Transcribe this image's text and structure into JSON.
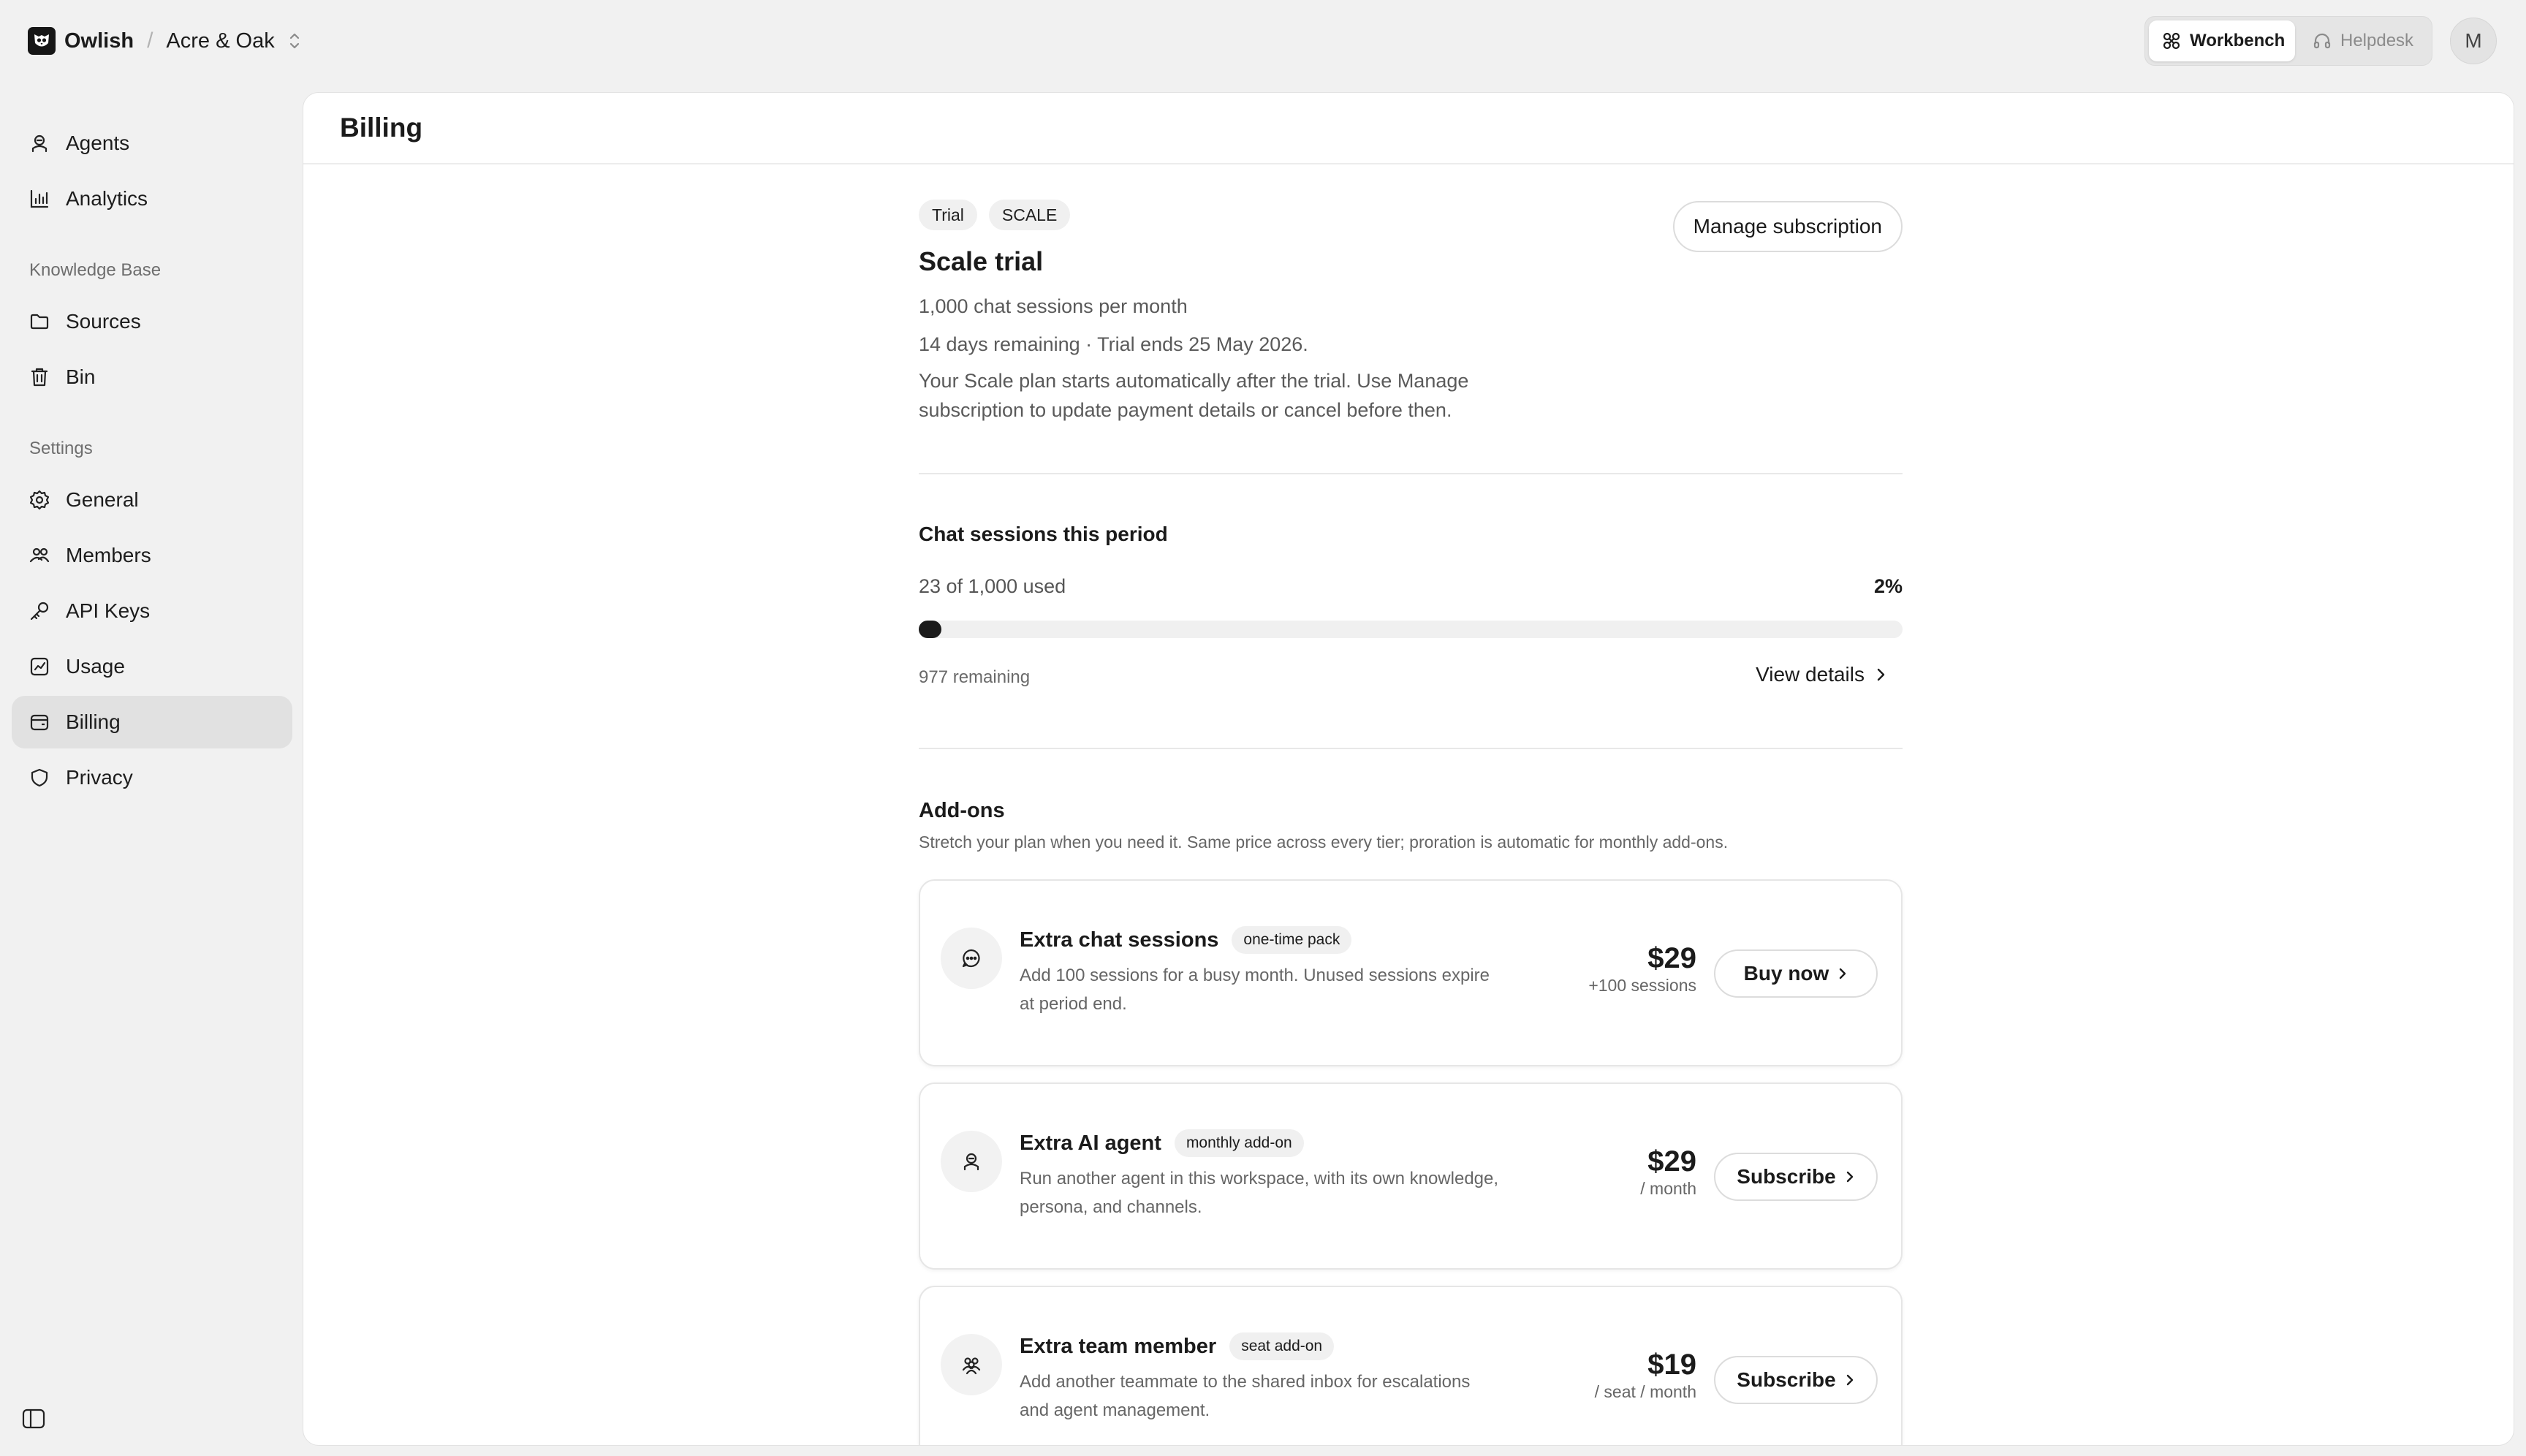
{
  "brand": {
    "name": "Owlish"
  },
  "workspace": {
    "name": "Acre & Oak"
  },
  "modes": {
    "workbench": "Workbench",
    "helpdesk": "Helpdesk"
  },
  "user": {
    "initial": "M"
  },
  "sidebar": {
    "top": [
      "Agents",
      "Analytics"
    ],
    "kb_heading": "Knowledge Base",
    "kb": [
      "Sources",
      "Bin"
    ],
    "settings_heading": "Settings",
    "settings": [
      "General",
      "Members",
      "API Keys",
      "Usage",
      "Billing",
      "Privacy"
    ],
    "active": "Billing"
  },
  "page": {
    "title": "Billing"
  },
  "plan": {
    "badges": [
      "Trial",
      "SCALE"
    ],
    "title": "Scale trial",
    "sessions": "1,000 chat sessions per month",
    "remaining": "14 days remaining · Trial ends 25 May 2026.",
    "note": "Your Scale plan starts automatically after the trial. Use Manage subscription to update payment details or cancel before then.",
    "manage_label": "Manage subscription"
  },
  "usage": {
    "title": "Chat sessions this period",
    "used_text": "23 of 1,000 used",
    "percent_label": "2%",
    "fraction": 0.023,
    "remaining_text": "977 remaining",
    "details_label": "View details"
  },
  "addons": {
    "title": "Add-ons",
    "subtitle": "Stretch your plan when you need it. Same price across every tier; proration is automatic for monthly add-ons.",
    "items": [
      {
        "name": "Extra chat sessions",
        "tag": "one-time pack",
        "desc": "Add 100 sessions for a busy month. Unused sessions expire at period end.",
        "price": "$29",
        "unit": "+100 sessions",
        "button": "Buy now",
        "icon": "chat-bubble-icon"
      },
      {
        "name": "Extra AI agent",
        "tag": "monthly add-on",
        "desc": "Run another agent in this workspace, with its own knowledge, persona, and channels.",
        "price": "$29",
        "unit": "/ month",
        "button": "Subscribe",
        "icon": "agent-icon"
      },
      {
        "name": "Extra team member",
        "tag": "seat add-on",
        "desc": "Add another teammate to the shared inbox for escalations and agent management.",
        "price": "$19",
        "unit": "/ seat / month",
        "button": "Subscribe",
        "icon": "team-icon"
      }
    ]
  },
  "colors": {
    "accent": "#1b1b1b",
    "background": "#f1f1f1",
    "panel": "#ffffff"
  }
}
